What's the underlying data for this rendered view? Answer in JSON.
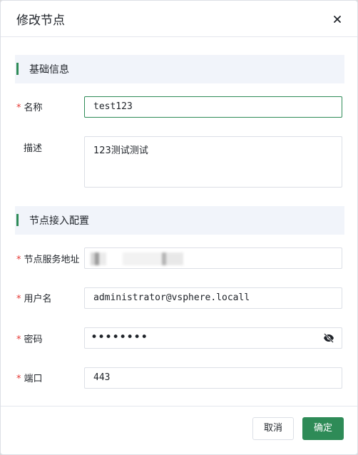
{
  "dialog": {
    "title": "修改节点",
    "close_icon": "close-icon"
  },
  "sections": {
    "basic": "基础信息",
    "access": "节点接入配置"
  },
  "fields": {
    "name": {
      "label": "名称",
      "required_mark": "*",
      "value": "test123"
    },
    "description": {
      "label": "描述",
      "value": "123测试测试"
    },
    "address": {
      "label": "节点服务地址",
      "required_mark": "*",
      "value": ""
    },
    "username": {
      "label": "用户名",
      "required_mark": "*",
      "value": "administrator@vsphere.locall"
    },
    "password": {
      "label": "密码",
      "required_mark": "*",
      "value": "••••••••",
      "toggle_icon": "eye-off-icon"
    },
    "port": {
      "label": "端口",
      "required_mark": "*",
      "value": "443"
    }
  },
  "footer": {
    "cancel_label": "取消",
    "confirm_label": "确定"
  },
  "colors": {
    "accent": "#2e8b57",
    "required": "#e53935",
    "section_bg": "#f1f4fa"
  }
}
